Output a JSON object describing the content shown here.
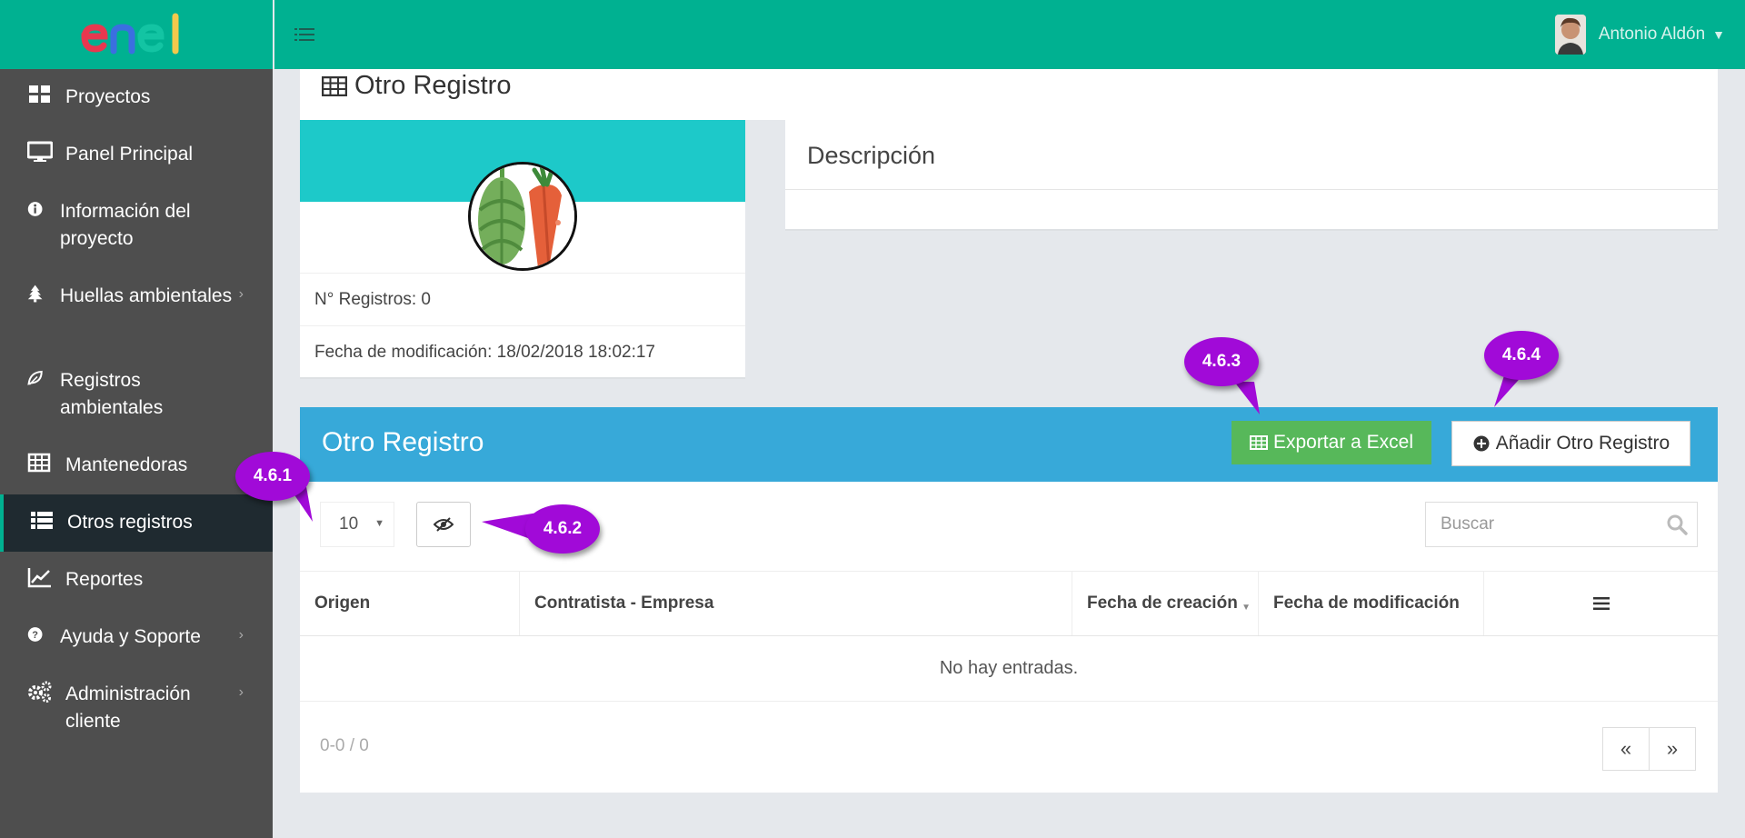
{
  "brand": {
    "logo_text": "enel",
    "accent": "#00b191"
  },
  "sidebar": {
    "items": [
      {
        "label": "Proyectos",
        "icon": "grid-icon"
      },
      {
        "label": "Panel Principal",
        "icon": "monitor-icon"
      },
      {
        "label": "Información del proyecto",
        "icon": "info-circle-icon"
      },
      {
        "label": "Huellas ambientales",
        "icon": "tree-icon"
      },
      {
        "label": "Registros ambientales",
        "icon": "leaf-icon"
      },
      {
        "label": "Mantenedoras",
        "icon": "table-icon"
      },
      {
        "label": "Otros registros",
        "icon": "list-icon"
      },
      {
        "label": "Reportes",
        "icon": "line-chart-icon"
      },
      {
        "label": "Ayuda y Soporte",
        "icon": "question-circle-icon"
      },
      {
        "label": "Administración cliente",
        "icon": "cogs-icon"
      }
    ],
    "active": "Otros registros"
  },
  "topbar": {
    "user_name": "Antonio Aldón"
  },
  "page": {
    "title": "Otro Registro"
  },
  "profile": {
    "records_label": "N° Registros: 0",
    "modified_label": "Fecha de modificación: 18/02/2018 18:02:17"
  },
  "description": {
    "title": "Descripción"
  },
  "table": {
    "title": "Otro Registro",
    "export_label": "Exportar a Excel",
    "add_label": "Añadir Otro Registro",
    "page_length": "10",
    "search_placeholder": "Buscar",
    "columns": [
      "Origen",
      "Contratista - Empresa",
      "Fecha de creación",
      "Fecha de modificación"
    ],
    "empty_text": "No hay entradas.",
    "info": "0-0 / 0",
    "prev": "«",
    "next": "»"
  },
  "callouts": [
    "4.6.1",
    "4.6.2",
    "4.6.3",
    "4.6.4"
  ],
  "colors": {
    "table_header": "#37a9d9",
    "export_btn": "#57b85a",
    "callout": "#a10ad8",
    "profile_band": "#1dc9c9"
  }
}
